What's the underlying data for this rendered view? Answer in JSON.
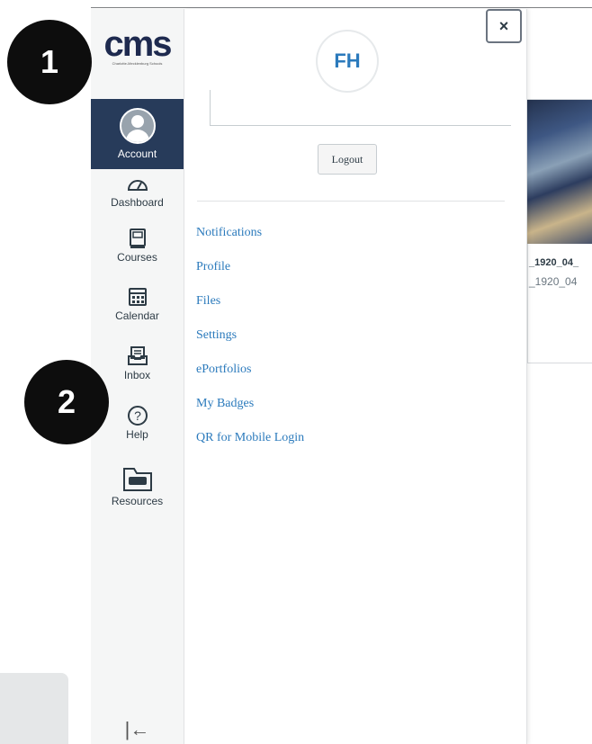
{
  "markers": [
    "1",
    "2"
  ],
  "nav": {
    "logo": "cms",
    "logo_tagline": "Charlotte-Mecklenburg Schools",
    "items": [
      {
        "label": "Account",
        "icon": "account-icon"
      },
      {
        "label": "Dashboard",
        "icon": "dashboard-icon"
      },
      {
        "label": "Courses",
        "icon": "courses-icon"
      },
      {
        "label": "Calendar",
        "icon": "calendar-icon"
      },
      {
        "label": "Inbox",
        "icon": "inbox-icon"
      },
      {
        "label": "Help",
        "icon": "help-icon"
      },
      {
        "label": "Resources",
        "icon": "resources-icon"
      }
    ],
    "collapse_glyph": "|←"
  },
  "tray": {
    "initials": "FH",
    "close_label": "×",
    "logout_label": "Logout",
    "links": [
      "Notifications",
      "Profile",
      "Files",
      "Settings",
      "ePortfolios",
      "My Badges",
      "QR for Mobile Login"
    ]
  },
  "background": {
    "card_title": "_1920_04_",
    "card_subtitle": "_1920_04"
  },
  "colors": {
    "nav_active": "#273b5a",
    "link": "#2b7abc",
    "nav_bg": "#f5f6f6"
  }
}
